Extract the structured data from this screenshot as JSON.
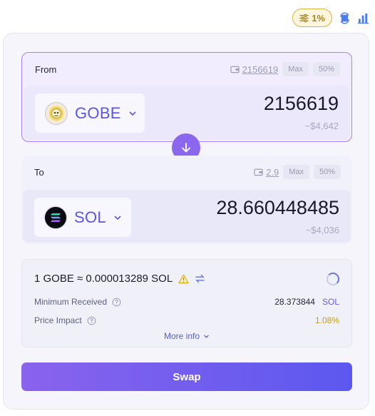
{
  "header": {
    "slippage_label": "1%",
    "slippage_icon": "sliders-icon",
    "refresh_icon": "refresh-icon",
    "chart_icon": "bar-chart-icon"
  },
  "from": {
    "label": "From",
    "balance": "2156619",
    "max_label": "Max",
    "half_label": "50%",
    "token_symbol": "GOBE",
    "amount": "2156619",
    "usd_value": "~$4,642"
  },
  "to": {
    "label": "To",
    "balance": "2.9",
    "max_label": "Max",
    "half_label": "50%",
    "token_symbol": "SOL",
    "amount": "28.660448485",
    "usd_value": "~$4,036"
  },
  "info": {
    "rate": "1 GOBE ≈ 0.000013289 SOL",
    "min_received_label": "Minimum Received",
    "min_received_value": "28.373844",
    "min_received_unit": "SOL",
    "price_impact_label": "Price Impact",
    "price_impact_value": "1.08%",
    "more_info_label": "More info"
  },
  "actions": {
    "swap_label": "Swap"
  },
  "colors": {
    "accent": "#8b67ee",
    "token_text": "#5a55e8",
    "warning": "#c09f18"
  }
}
